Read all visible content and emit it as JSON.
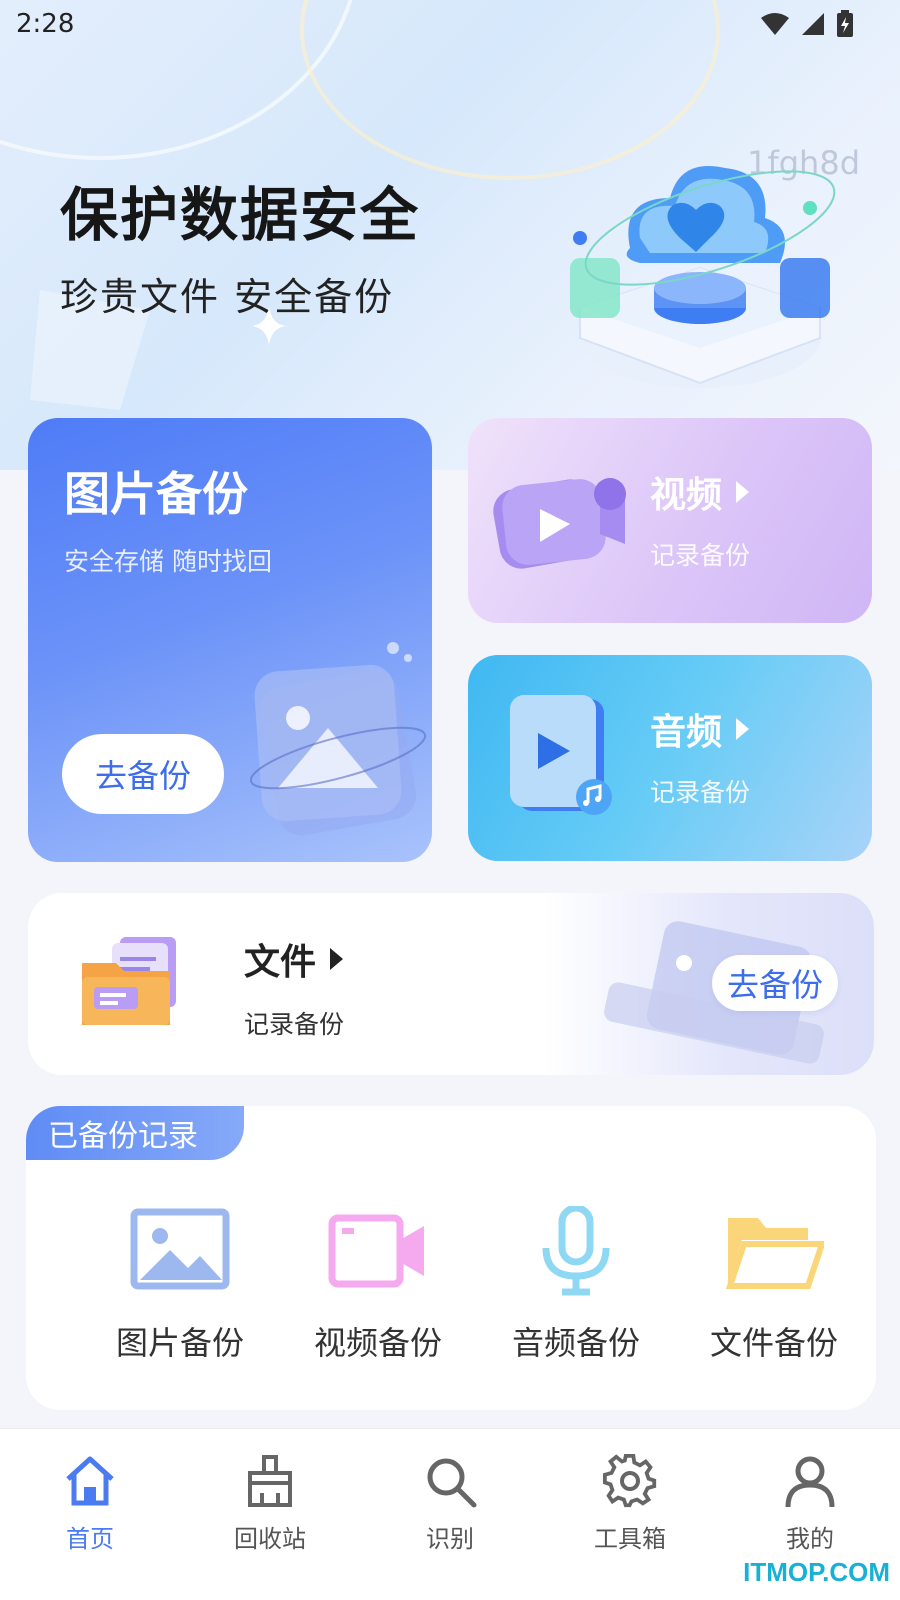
{
  "status_bar": {
    "time": "2:28"
  },
  "watermark": "1fgh8d",
  "hero": {
    "title": "保护数据安全",
    "subtitle": "珍贵文件 安全备份"
  },
  "cards": {
    "photo": {
      "title": "图片备份",
      "subtitle": "安全存储 随时找回",
      "button": "去备份"
    },
    "video": {
      "title": "视频",
      "subtitle": "记录备份"
    },
    "audio": {
      "title": "音频",
      "subtitle": "记录备份"
    },
    "file": {
      "title": "文件",
      "subtitle": "记录备份",
      "button": "去备份"
    }
  },
  "records": {
    "tag": "已备份记录",
    "items": [
      {
        "label": "图片备份",
        "icon": "image-icon",
        "color": "#9db8ee"
      },
      {
        "label": "视频备份",
        "icon": "video-camera-icon",
        "color": "#f5a9ee"
      },
      {
        "label": "音频备份",
        "icon": "microphone-icon",
        "color": "#8fd8f4"
      },
      {
        "label": "文件备份",
        "icon": "folder-icon",
        "color": "#fbd57a"
      }
    ]
  },
  "tabbar": {
    "items": [
      {
        "label": "首页",
        "icon": "home-icon",
        "active": true
      },
      {
        "label": "回收站",
        "icon": "broom-icon",
        "active": false
      },
      {
        "label": "识别",
        "icon": "search-icon",
        "active": false
      },
      {
        "label": "工具箱",
        "icon": "gear-icon",
        "active": false
      },
      {
        "label": "我的",
        "icon": "user-icon",
        "active": false
      }
    ]
  },
  "footer_watermark": "ITMOP.COM",
  "colors": {
    "accent": "#4a7bf0",
    "photo_card": "#4f7cf7",
    "audio_card": "#3fb8f2",
    "video_card": "#dcc6f8"
  }
}
